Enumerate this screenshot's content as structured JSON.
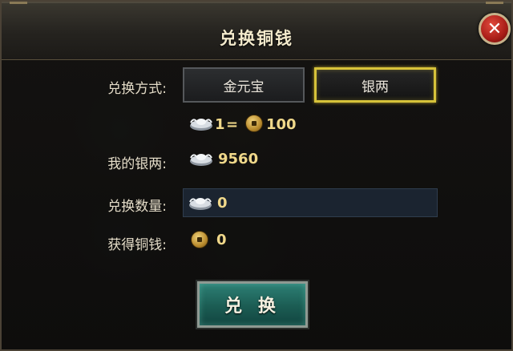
{
  "dialog": {
    "title": "兑换铜钱",
    "close_symbol": "✕"
  },
  "method": {
    "label": "兑换方式:",
    "options": [
      "金元宝",
      "银两"
    ],
    "selected": "银两"
  },
  "rate": {
    "left": "1",
    "equals": "=",
    "right": "100"
  },
  "my_silver": {
    "label": "我的银两:",
    "value": "9560"
  },
  "quantity": {
    "label": "兑换数量:",
    "value": "0"
  },
  "obtained": {
    "label": "获得铜钱:",
    "value": "0"
  },
  "exchange_button": {
    "label": "兑 换"
  },
  "icons": {
    "silver": "silver-ingot-icon",
    "copper": "copper-coin-icon",
    "close": "close-icon"
  },
  "colors": {
    "selected_border": "#d6c23a",
    "value_text": "#f0d88a",
    "button_teal": "#1b5c53",
    "close_red": "#a81d17"
  }
}
